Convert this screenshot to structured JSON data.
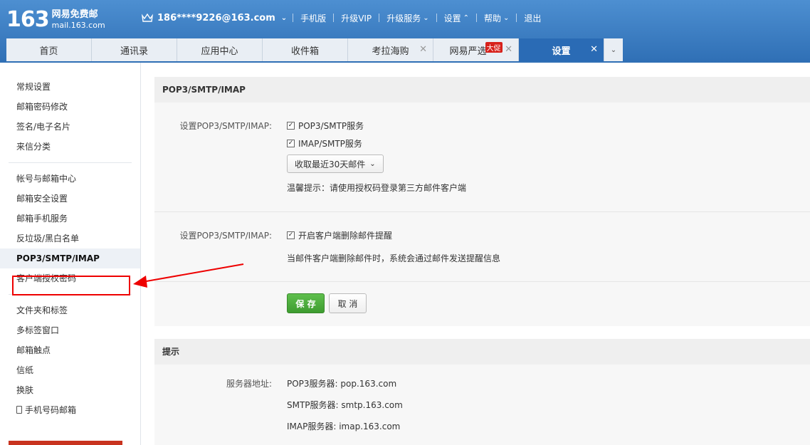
{
  "header": {
    "logo_number": "163",
    "logo_cn": "网易免费邮",
    "logo_domain": "mail.163.com",
    "user_email": "186****9226@163.com",
    "nav": [
      "手机版",
      "升级VIP",
      "升级服务",
      "设置",
      "帮助",
      "退出"
    ]
  },
  "tabs": [
    {
      "label": "首页"
    },
    {
      "label": "通讯录"
    },
    {
      "label": "应用中心"
    },
    {
      "label": "收件箱"
    },
    {
      "label": "考拉海购"
    },
    {
      "label": "网易严选",
      "badge": "大促"
    },
    {
      "label": "设置"
    }
  ],
  "sidebar": {
    "group1": [
      "常规设置",
      "邮箱密码修改",
      "签名/电子名片",
      "来信分类"
    ],
    "group2": [
      "帐号与邮箱中心",
      "邮箱安全设置",
      "邮箱手机服务",
      "反垃圾/黑白名单",
      "POP3/SMTP/IMAP",
      "客户端授权密码"
    ],
    "group3": [
      "文件夹和标签",
      "多标签窗口",
      "邮箱触点",
      "信纸",
      "换肤",
      "手机号码邮箱"
    ]
  },
  "main": {
    "section_title": "POP3/SMTP/IMAP",
    "row1_label": "设置POP3/SMTP/IMAP:",
    "pop3_smtp": "POP3/SMTP服务",
    "imap_smtp": "IMAP/SMTP服务",
    "fetch_dropdown": "收取最近30天邮件",
    "warm_tip": "温馨提示：请使用授权码登录第三方邮件客户端",
    "row2_label": "设置POP3/SMTP/IMAP:",
    "delete_notify": "开启客户端删除邮件提醒",
    "delete_notify_desc": "当邮件客户端删除邮件时，系统会通过邮件发送提醒信息",
    "save_label": "保 存",
    "cancel_label": "取 消",
    "tips_title": "提示",
    "server_label": "服务器地址:",
    "servers": [
      "POP3服务器: pop.163.com",
      "SMTP服务器: smtp.163.com",
      "IMAP服务器: imap.163.com"
    ]
  },
  "colors": {
    "brand": "#2f6fb5",
    "save": "#3e9c30",
    "annotation": "#e00000"
  }
}
